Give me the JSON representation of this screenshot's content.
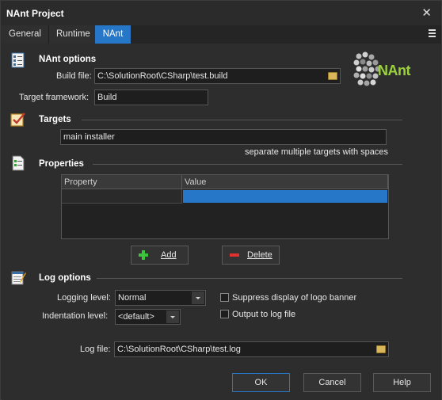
{
  "window": {
    "title": "NAnt Project",
    "close_glyph": "✕"
  },
  "tabs": [
    {
      "label": "General"
    },
    {
      "label": "Runtime"
    },
    {
      "label": "NAnt"
    }
  ],
  "nant_options": {
    "heading": "NAnt options",
    "build_file_label": "Build file:",
    "build_file_value": "C:\\SolutionRoot\\CSharp\\test.build",
    "target_framework_label": "Target framework:",
    "target_framework_value": "Build",
    "logo_text": "NAnt"
  },
  "targets": {
    "heading": "Targets",
    "value": "main installer",
    "hint": "separate multiple targets with spaces"
  },
  "properties": {
    "heading": "Properties",
    "columns": [
      "Property",
      "Value"
    ],
    "add_label": "Add",
    "delete_label": "Delete"
  },
  "log_options": {
    "heading": "Log options",
    "logging_level_label": "Logging level:",
    "logging_level_value": "Normal",
    "indentation_level_label": "Indentation level:",
    "indentation_level_value": "<default>",
    "suppress_logo_label": "Suppress display of logo banner",
    "output_to_log_label": "Output to log file",
    "log_file_label": "Log file:",
    "log_file_value": "C:\\SolutionRoot\\CSharp\\test.log"
  },
  "footer": {
    "ok_label": "OK",
    "cancel_label": "Cancel",
    "help_label": "Help"
  },
  "colors": {
    "accent": "#2677c8",
    "background": "#2d2d2d",
    "add_icon": "#3cc43c",
    "delete_icon": "#e03030"
  }
}
